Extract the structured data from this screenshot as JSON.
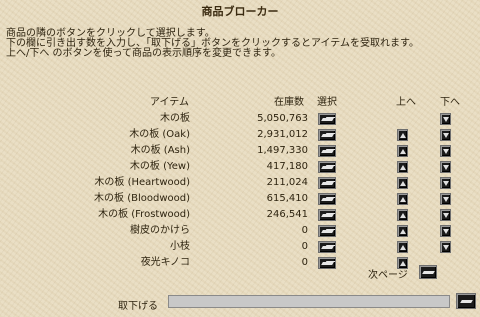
{
  "window": {
    "title": "商品ブローカー"
  },
  "instructions": [
    "商品の隣のボタンをクリックして選択します。",
    "下の欄に引き出す数を入力し、「取下げる」ボタンをクリックするとアイテムを受取れます。",
    "上へ/下へ のボタンを使って商品の表示順序を変更できます。"
  ],
  "headers": {
    "item": "アイテム",
    "stock": "在庫数",
    "select": "選択",
    "up": "上へ",
    "down": "下へ"
  },
  "items": [
    {
      "name": "木の板",
      "stock": "5,050,763"
    },
    {
      "name": "木の板 (Oak)",
      "stock": "2,931,012"
    },
    {
      "name": "木の板 (Ash)",
      "stock": "1,497,330"
    },
    {
      "name": "木の板 (Yew)",
      "stock": "417,180"
    },
    {
      "name": "木の板 (Heartwood)",
      "stock": "211,024"
    },
    {
      "name": "木の板 (Bloodwood)",
      "stock": "615,410"
    },
    {
      "name": "木の板 (Frostwood)",
      "stock": "246,541"
    },
    {
      "name": "樹皮のかけら",
      "stock": "0"
    },
    {
      "name": "小枝",
      "stock": "0"
    },
    {
      "name": "夜光キノコ",
      "stock": "0"
    }
  ],
  "footer": {
    "next_page": "次ページ",
    "withdraw_label": "取下げる",
    "quantity_value": ""
  }
}
